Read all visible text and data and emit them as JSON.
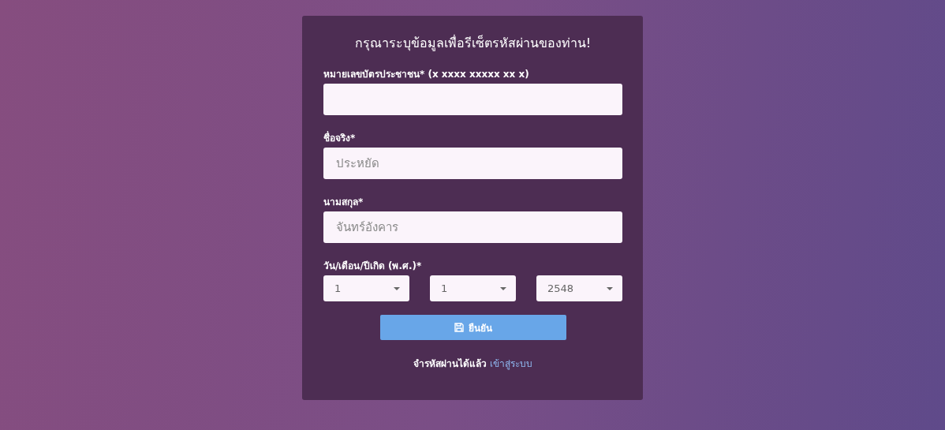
{
  "title": "กรุณาระบุข้อมูลเพื่อรีเซ็ตรหัสผ่านของท่าน!",
  "fields": [
    {
      "label": "หมายเลขบัตรประชาชน* (x xxxx xxxxx xx x)"
    },
    {
      "label": "ชื่อจริง*",
      "placeholder": "ประหยัด"
    },
    {
      "label": "นามสกุล*",
      "placeholder": "จันทร์อังคาร"
    }
  ],
  "birth_date": {
    "label": "วัน/เดือน/ปีเกิด (พ.ศ.)*",
    "selects": [
      {
        "value": "1"
      },
      {
        "value": "1"
      },
      {
        "value": "2548"
      }
    ]
  },
  "submit_button": {
    "label": "ยืนยัน"
  },
  "footer": {
    "text": "จำรหัสผ่านได้แล้ว",
    "link": "เข้าสู่ระบบ"
  }
}
